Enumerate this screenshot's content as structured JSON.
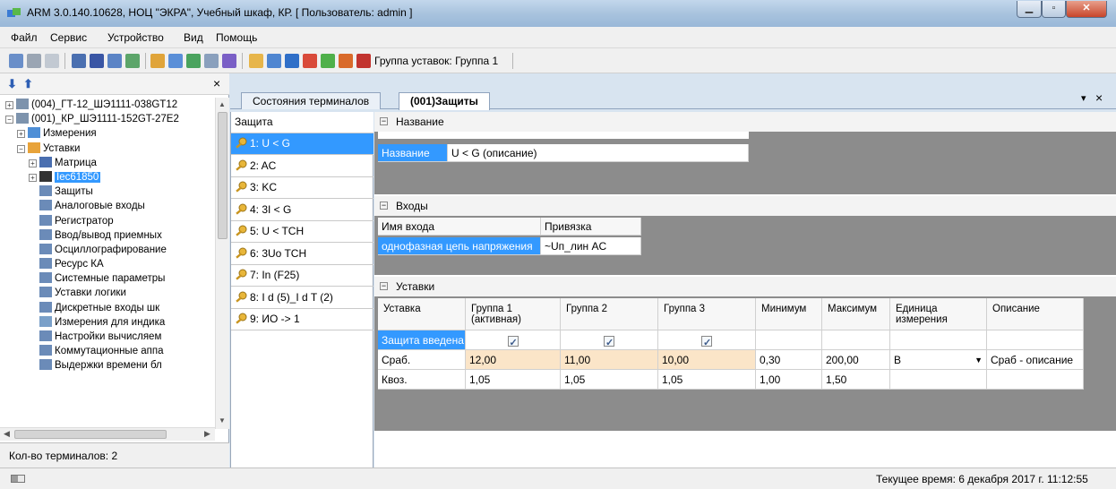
{
  "window": {
    "title": "ARM 3.0.140.10628, НОЦ \"ЭКРА\", Учебный шкаф, КР. [ Пользователь: admin ]"
  },
  "menu": [
    "Файл",
    "Сервис",
    "Устройство",
    "Вид",
    "Помощь"
  ],
  "toolbar": {
    "group_label": "Группа уставок: Группа 1"
  },
  "left_panel": {
    "close": "×",
    "tree": [
      {
        "label": "(004)_ГТ-12_ШЭ1111-038GT12",
        "level": 0,
        "icon": "cabinet-icon",
        "exp": "+"
      },
      {
        "label": "(001)_КР_ШЭ1111-152GT-27E2",
        "level": 0,
        "icon": "cabinet-icon",
        "exp": "−"
      },
      {
        "label": "Измерения",
        "level": 1,
        "icon": "measurements-icon",
        "exp": "+"
      },
      {
        "label": "Уставки",
        "level": 1,
        "icon": "folder-icon",
        "exp": "−"
      },
      {
        "label": "Матрица",
        "level": 2,
        "icon": "matrix-icon",
        "exp": "+"
      },
      {
        "label": "Iec61850",
        "level": 2,
        "icon": "iec-icon",
        "exp": "+",
        "selected": true
      },
      {
        "label": "Защиты",
        "level": 2,
        "icon": "table-icon"
      },
      {
        "label": "Аналоговые входы",
        "level": 2,
        "icon": "table-icon"
      },
      {
        "label": "Регистратор",
        "level": 2,
        "icon": "table-icon"
      },
      {
        "label": "Ввод/вывод приемных",
        "level": 2,
        "icon": "table-icon"
      },
      {
        "label": "Осциллографирование",
        "level": 2,
        "icon": "table-icon"
      },
      {
        "label": "Ресурс КА",
        "level": 2,
        "icon": "table-icon"
      },
      {
        "label": "Системные параметры",
        "level": 2,
        "icon": "table-icon"
      },
      {
        "label": "Уставки логики",
        "level": 2,
        "icon": "table-icon"
      },
      {
        "label": "Дискретные входы шк",
        "level": 2,
        "icon": "table-icon"
      },
      {
        "label": "Измерения для индика",
        "level": 2,
        "icon": "measure-tool-icon"
      },
      {
        "label": "Настройки вычисляем",
        "level": 2,
        "icon": "table-icon"
      },
      {
        "label": "Коммутационные аппа",
        "level": 2,
        "icon": "table-icon"
      },
      {
        "label": "Выдержки времени бл",
        "level": 2,
        "icon": "table-icon"
      }
    ],
    "terminal_count": "Кол-во терминалов: 2"
  },
  "tabs": [
    {
      "label": "Состояния терминалов",
      "active": false
    },
    {
      "label": "(001)Защиты",
      "active": true
    }
  ],
  "protections": {
    "header": "Защита",
    "items": [
      {
        "label": "1: U < G",
        "selected": true
      },
      {
        "label": "2: AC"
      },
      {
        "label": "3: KC"
      },
      {
        "label": "4: 3I < G"
      },
      {
        "label": "5: U < TCH"
      },
      {
        "label": "6: 3Uo TCH"
      },
      {
        "label": "7: In (F25)"
      },
      {
        "label": "8: I d (5)_I d T (2)"
      },
      {
        "label": "9: ИО -> 1"
      }
    ]
  },
  "name_section": {
    "title": "Название",
    "field_label": "Название",
    "field_value": "U < G (описание)"
  },
  "inputs_section": {
    "title": "Входы",
    "col_name": "Имя входа",
    "col_binding": "Привязка",
    "rows": [
      {
        "name": "однофазная цепь напряжения",
        "binding": "~Uп_лин AC"
      }
    ]
  },
  "settings_section": {
    "title": "Уставки",
    "headers": [
      "Уставка",
      "Группа 1 (активная)",
      "Группа 2",
      "Группа 3",
      "Минимум",
      "Максимум",
      "Единица измерения",
      "Описание"
    ],
    "rows": [
      {
        "name": "Защита введена",
        "g1": true,
        "g2": true,
        "g3": true,
        "min": "",
        "max": "",
        "unit": "",
        "desc": ""
      },
      {
        "name": "Сраб.",
        "g1": "12,00",
        "g2": "11,00",
        "g3": "10,00",
        "min": "0,30",
        "max": "200,00",
        "unit": "В",
        "desc": "Сраб - описание"
      },
      {
        "name": "Квоз.",
        "g1": "1,05",
        "g2": "1,05",
        "g3": "1,05",
        "min": "1,00",
        "max": "1,50",
        "unit": "",
        "desc": ""
      }
    ]
  },
  "status": {
    "time": "Текущее время: 6 декабря 2017 г. 11:12:55"
  }
}
